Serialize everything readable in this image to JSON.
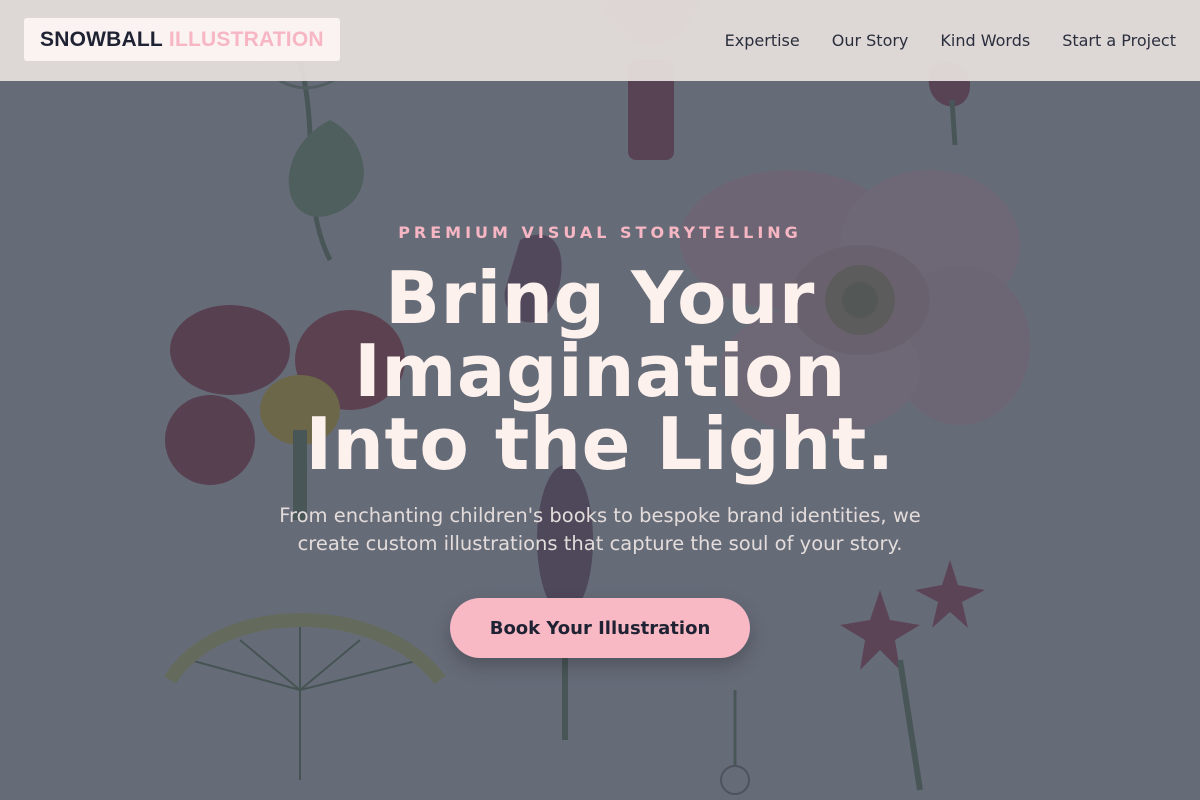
{
  "brand": {
    "name_part1": "SNOWBALL",
    "name_part2": "ILLUSTRATION",
    "accent_color": "#f7b6c3",
    "dark_color": "#1e2233"
  },
  "nav": {
    "items": [
      {
        "label": "Expertise"
      },
      {
        "label": "Our Story"
      },
      {
        "label": "Kind Words"
      },
      {
        "label": "Start a Project"
      }
    ]
  },
  "hero": {
    "eyebrow": "PREMIUM VISUAL STORYTELLING",
    "headline_lines": [
      "Bring Your",
      "Imagination",
      "Into the Light."
    ],
    "subtitle": "From enchanting children's books to bespoke brand identities, we create custom illustrations that capture the soul of your story.",
    "cta_label": "Book Your Illustration",
    "background": "botanical-flower-illustrations"
  }
}
